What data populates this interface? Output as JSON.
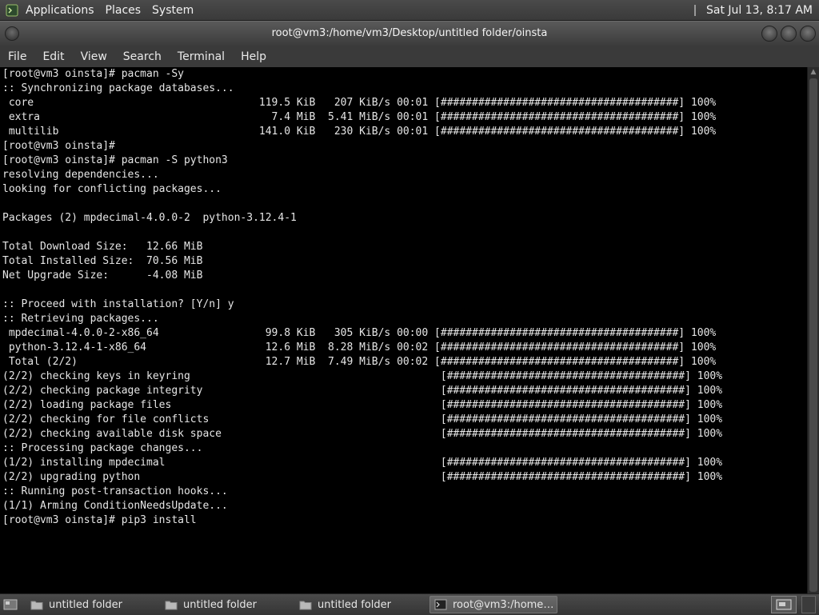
{
  "top_panel": {
    "menus": [
      "Applications",
      "Places",
      "System"
    ],
    "clock": "Sat Jul 13,  8:17 AM"
  },
  "window": {
    "title": "root@vm3:/home/vm3/Desktop/untitled folder/oinsta",
    "menus": [
      "File",
      "Edit",
      "View",
      "Search",
      "Terminal",
      "Help"
    ]
  },
  "terminal": {
    "lines": [
      "[root@vm3 oinsta]# pacman -Sy",
      ":: Synchronizing package databases...",
      " core                                    119.5 KiB   207 KiB/s 00:01 [######################################] 100%",
      " extra                                     7.4 MiB  5.41 MiB/s 00:01 [######################################] 100%",
      " multilib                                141.0 KiB   230 KiB/s 00:01 [######################################] 100%",
      "[root@vm3 oinsta]#",
      "[root@vm3 oinsta]# pacman -S python3",
      "resolving dependencies...",
      "looking for conflicting packages...",
      "",
      "Packages (2) mpdecimal-4.0.0-2  python-3.12.4-1",
      "",
      "Total Download Size:   12.66 MiB",
      "Total Installed Size:  70.56 MiB",
      "Net Upgrade Size:      -4.08 MiB",
      "",
      ":: Proceed with installation? [Y/n] y",
      ":: Retrieving packages...",
      " mpdecimal-4.0.0-2-x86_64                 99.8 KiB   305 KiB/s 00:00 [######################################] 100%",
      " python-3.12.4-1-x86_64                   12.6 MiB  8.28 MiB/s 00:02 [######################################] 100%",
      " Total (2/2)                              12.7 MiB  7.49 MiB/s 00:02 [######################################] 100%",
      "(2/2) checking keys in keyring                                        [######################################] 100%",
      "(2/2) checking package integrity                                      [######################################] 100%",
      "(2/2) loading package files                                           [######################################] 100%",
      "(2/2) checking for file conflicts                                     [######################################] 100%",
      "(2/2) checking available disk space                                   [######################################] 100%",
      ":: Processing package changes...",
      "(1/2) installing mpdecimal                                            [######################################] 100%",
      "(2/2) upgrading python                                                [######################################] 100%",
      ":: Running post-transaction hooks...",
      "(1/1) Arming ConditionNeedsUpdate...",
      "[root@vm3 oinsta]# pip3 install"
    ]
  },
  "taskbar": {
    "tasks": [
      {
        "label": "untitled folder",
        "icon": "folder-icon"
      },
      {
        "label": "untitled folder",
        "icon": "folder-icon"
      },
      {
        "label": "untitled folder",
        "icon": "folder-icon"
      },
      {
        "label": "root@vm3:/home/v...",
        "icon": "terminal-icon"
      }
    ]
  },
  "colors": {
    "terminal_bg": "#000000",
    "terminal_fg": "#e6e6e6",
    "panel_bg": "#3d3d3d"
  }
}
